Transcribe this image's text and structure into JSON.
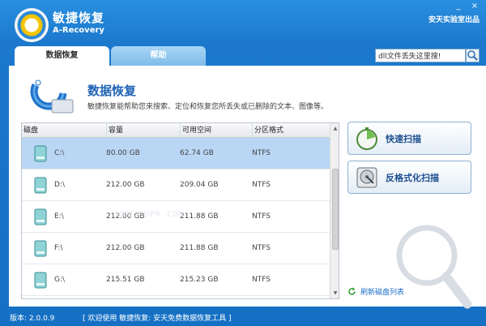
{
  "window": {
    "minimize_glyph": "_",
    "close_glyph": "×"
  },
  "header": {
    "brand_cn": "敏捷恢复",
    "brand_en": "A-Recovery",
    "vendor": "安天实验室出品",
    "logo_icon": "recovery-logo-icon"
  },
  "tabs": [
    {
      "label": "数据恢复",
      "active": true
    },
    {
      "label": "帮助",
      "active": false
    }
  ],
  "search": {
    "value": "dll文件丢失这里搜!",
    "icon": "search-icon"
  },
  "main": {
    "title": "数据恢复",
    "description": "敏捷恢复能帮助您来搜索、定位和恢复您所丢失或已删除的文本、图像等。"
  },
  "table": {
    "columns": [
      "磁盘",
      "容量",
      "可用空间",
      "分区格式"
    ],
    "rows": [
      {
        "name": "C:\\",
        "capacity": "80.00 GB",
        "free": "62.74 GB",
        "fs": "NTFS",
        "selected": true
      },
      {
        "name": "D:\\",
        "capacity": "212.00 GB",
        "free": "209.04 GB",
        "fs": "NTFS",
        "selected": false
      },
      {
        "name": "E:\\",
        "capacity": "212.00 GB",
        "free": "211.88 GB",
        "fs": "NTFS",
        "selected": false
      },
      {
        "name": "F:\\",
        "capacity": "212.00 GB",
        "free": "211.88 GB",
        "fs": "NTFS",
        "selected": false
      },
      {
        "name": "G:\\",
        "capacity": "215.51 GB",
        "free": "215.23 GB",
        "fs": "NTFS",
        "selected": false
      }
    ]
  },
  "watermark": "WWW.9UPK.COM",
  "actions": {
    "quick_scan": "快速扫描",
    "unformat_scan": "反格式化扫描"
  },
  "refresh": {
    "label": "刷新磁盘列表"
  },
  "footer": {
    "version": "版本: 2.0.0.9",
    "welcome": "[ 欢迎使用 敏捷恢复: 安天免费数据恢复工具 ]"
  },
  "colors": {
    "accent": "#1b78cc",
    "selected_row": "#b9d7f5",
    "title_blue": "#1e62b4"
  }
}
